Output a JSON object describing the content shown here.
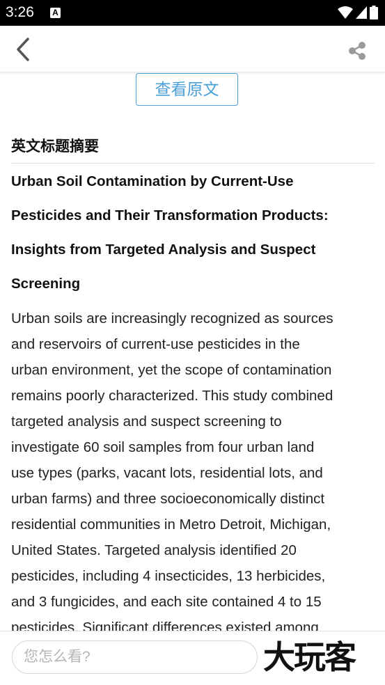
{
  "status_bar": {
    "time": "3:26",
    "notification_icon": "A",
    "icons": [
      "wifi-icon",
      "signal-icon",
      "battery-icon"
    ]
  },
  "app_bar": {
    "back_icon": "chevron-left-icon",
    "share_icon": "share-icon"
  },
  "content": {
    "view_original_label": "查看原文",
    "section_heading": "英文标题摘要",
    "english_title_lines": [
      "Urban Soil Contamination by Current-Use",
      "Pesticides and Their Transformation Products:",
      "Insights from Targeted Analysis and Suspect",
      "Screening"
    ],
    "abstract_lines": [
      "Urban soils are increasingly recognized as sources",
      "and reservoirs of current-use pesticides in the",
      "urban environment, yet the scope of contamination",
      "remains poorly characterized. This study combined",
      "targeted analysis and suspect screening to",
      "investigate 60 soil samples from four urban land",
      "use types (parks, vacant lots, residential lots, and",
      "urban farms) and three socioeconomically distinct",
      "residential communities in Metro Detroit, Michigan,",
      "United States. Targeted analysis identified 20",
      "pesticides, including 4 insecticides, 13 herbicides,",
      "and 3 fungicides, and each site contained 4 to 15",
      "pesticides. Significant differences existed among"
    ]
  },
  "bottom_bar": {
    "comment_placeholder": "您怎么看?",
    "brand_logo_text": "大玩客"
  },
  "colors": {
    "accent": "#4a9fd8",
    "status_bar_bg": "#000000",
    "text_primary": "#111111",
    "placeholder": "#b5b5b5"
  }
}
